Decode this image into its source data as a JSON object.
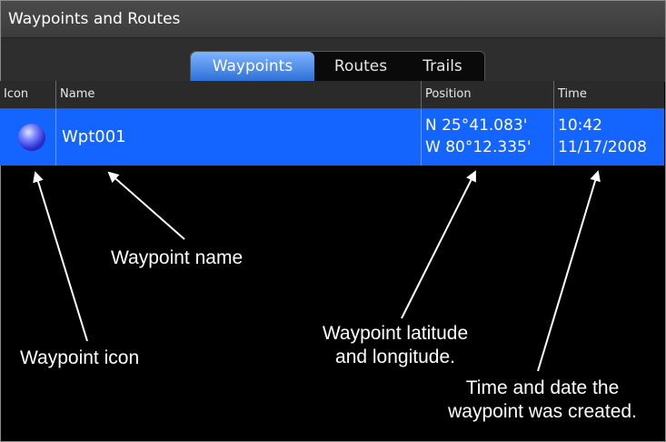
{
  "window": {
    "title": "Waypoints and Routes"
  },
  "tabs": [
    {
      "label": "Waypoints",
      "active": true
    },
    {
      "label": "Routes",
      "active": false
    },
    {
      "label": "Trails",
      "active": false
    }
  ],
  "columns": {
    "icon": "Icon",
    "name": "Name",
    "position": "Position",
    "time": "Time"
  },
  "rows": [
    {
      "icon": "blue-circle-waypoint-icon",
      "name": "Wpt001",
      "lat": "N  25°41.083'",
      "lon": "W  80°12.335'",
      "time": "10:42",
      "date": "11/17/2008"
    }
  ],
  "annotations": {
    "name": "Waypoint name",
    "icon": "Waypoint icon",
    "position": [
      "Waypoint latitude",
      "and longitude."
    ],
    "time": [
      "Time and date the",
      "waypoint was created."
    ]
  },
  "colors": {
    "selected_row": "#1464ff",
    "background": "#000000",
    "titlebar": "#444444",
    "active_tab": "#2a6fd6"
  }
}
